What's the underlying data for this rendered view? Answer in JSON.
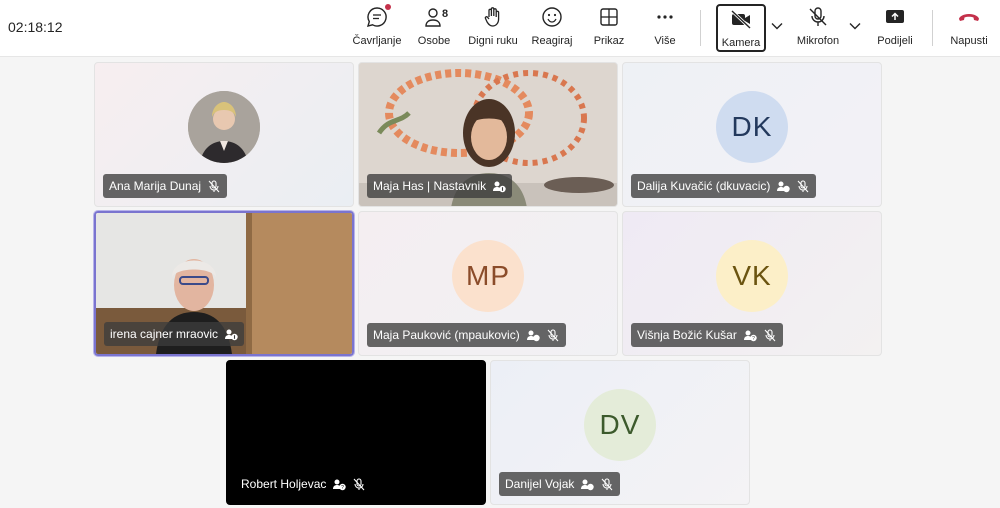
{
  "meeting": {
    "timer": "02:18:12"
  },
  "toolbar": {
    "chat_label": "Čavrljanje",
    "people_label": "Osobe",
    "people_count": "8",
    "raise_hand_label": "Digni ruku",
    "react_label": "Reagiraj",
    "view_label": "Prikaz",
    "more_label": "Više",
    "camera_label": "Kamera",
    "mic_label": "Mikrofon",
    "share_label": "Podijeli",
    "leave_label": "Napusti"
  },
  "participants": [
    {
      "name": "Ana Marija Dunaj",
      "muted": true
    },
    {
      "name": "Maja Has | Nastavnik",
      "muted": false
    },
    {
      "name": "Dalija Kuvačić (dkuvacic)",
      "initials": "DK",
      "muted": true
    },
    {
      "name": "irena cajner mraovic",
      "muted": false
    },
    {
      "name": "Maja Pauković (mpaukovic)",
      "initials": "MP",
      "muted": true
    },
    {
      "name": "Višnja Božić Kušar",
      "initials": "VK",
      "muted": true
    },
    {
      "name": "Robert Holjevac",
      "muted": true
    },
    {
      "name": "Danijel Vojak",
      "initials": "DV",
      "muted": true
    }
  ],
  "colors": {
    "accent": "#7a74cf",
    "leave": "#c4314b"
  }
}
